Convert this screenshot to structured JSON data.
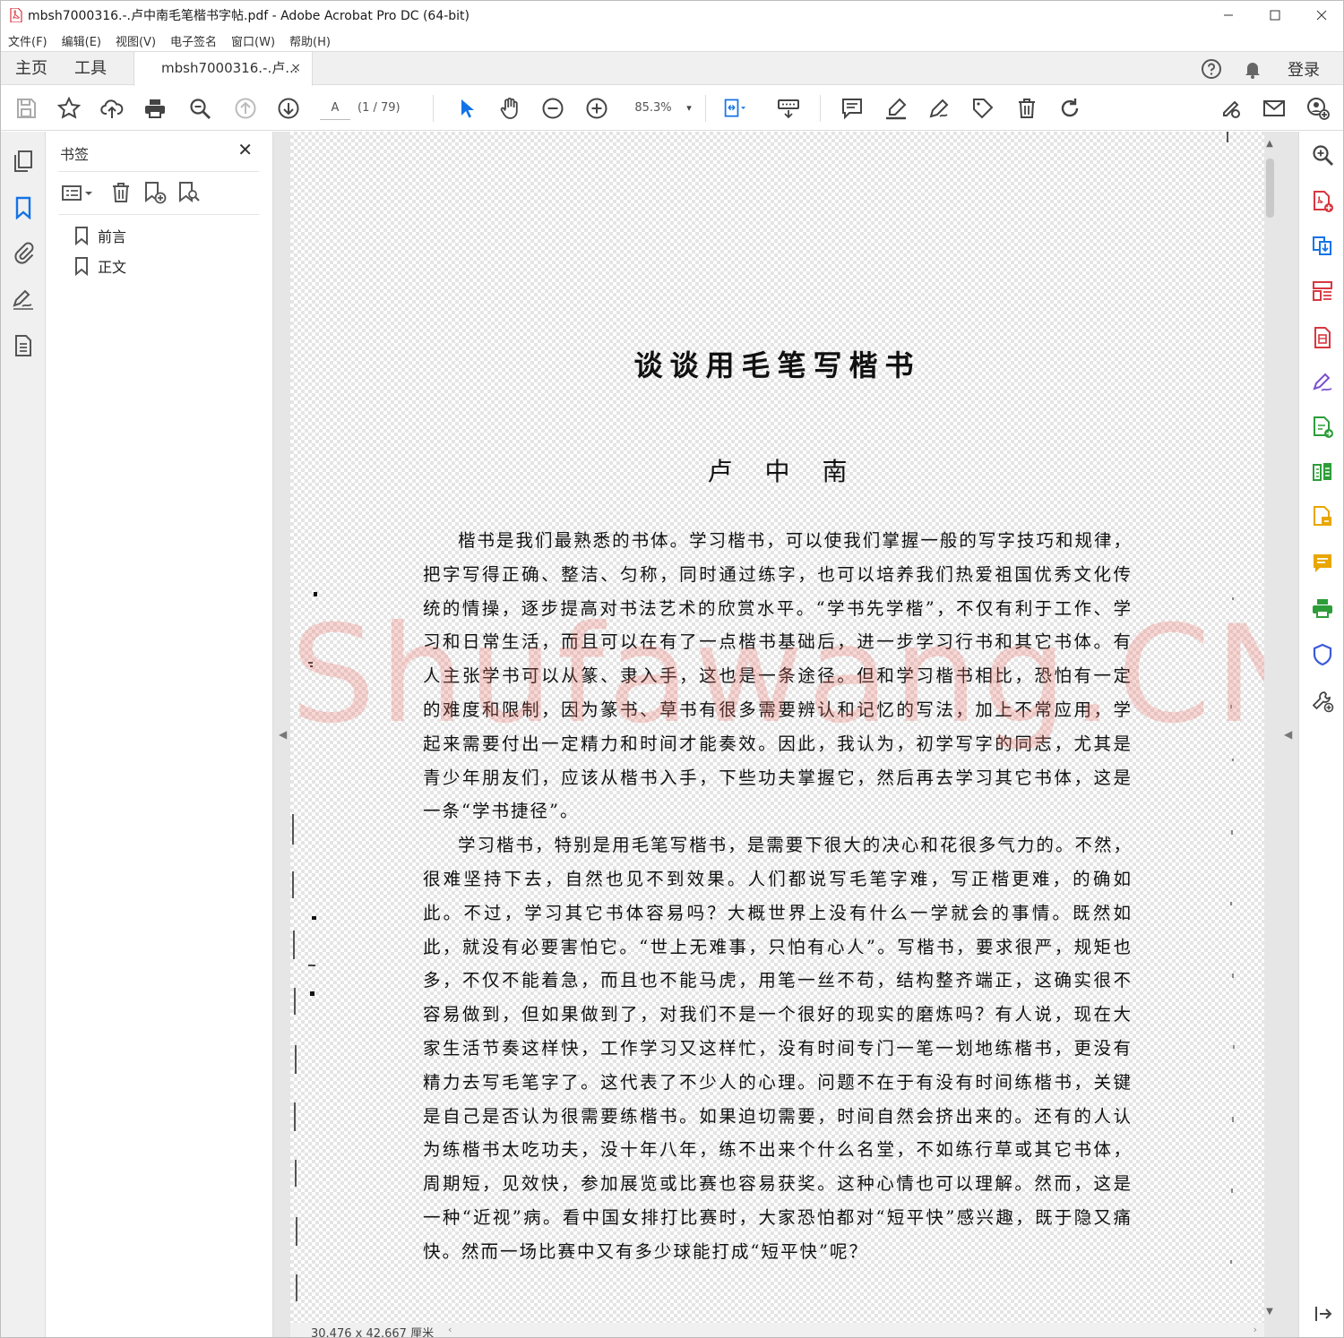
{
  "window": {
    "title": "mbsh7000316.-.卢中南毛笔楷书字帖.pdf - Adobe Acrobat Pro DC (64-bit)",
    "minimize": "—",
    "maximize": "☐",
    "close": "✕"
  },
  "menu": [
    "文件(F)",
    "编辑(E)",
    "视图(V)",
    "电子签名",
    "窗口(W)",
    "帮助(H)"
  ],
  "tabs": {
    "home": "主页",
    "tools": "工具",
    "document": "mbsh7000316.-.卢...",
    "document_close": "×",
    "login": "登录"
  },
  "toolbar": {
    "page_input": "A",
    "page_count": "(1 / 79)",
    "zoom": "85.3%",
    "zoom_dropdown": "▾"
  },
  "bookmarks": {
    "title": "书签",
    "close": "✕",
    "items": [
      "前言",
      "正文"
    ]
  },
  "document": {
    "title": "谈谈用毛笔写楷书",
    "author": "卢中南",
    "paragraphs": [
      "楷书是我们最熟悉的书体。学习楷书，可以使我们掌握一般的写字技巧和规律，把字写得正确、整洁、匀称，同时通过练字，也可以培养我们热爱祖国优秀文化传统的情操，逐步提高对书法艺术的欣赏水平。“学书先学楷”，不仅有利于工作、学习和日常生活，而且可以在有了一点楷书基础后，进一步学习行书和其它书体。有人主张学书可以从篆、隶入手，这也是一条途径。但和学习楷书相比，恐怕有一定的难度和限制，因为篆书、草书有很多需要辨认和记忆的写法，加上不常应用，学起来需要付出一定精力和时间才能奏效。因此，我认为，初学写字的同志，尤其是青少年朋友们，应该从楷书入手，下些功夫掌握它，然后再去学习其它书体，这是一条“学书捷径”。",
      "学习楷书，特别是用毛笔写楷书，是需要下很大的决心和花很多气力的。不然，很难坚持下去，自然也见不到效果。人们都说写毛笔字难，写正楷更难，的确如此。不过，学习其它书体容易吗？大概世界上没有什么一学就会的事情。既然如此，就没有必要害怕它。“世上无难事，只怕有心人”。写楷书，要求很严，规矩也多，不仅不能着急，而且也不能马虎，用笔一丝不苟，结构整齐端正，这确实很不容易做到，但如果做到了，对我们不是一个很好的现实的磨炼吗？有人说，现在大家生活节奏这样快，工作学习又这样忙，没有时间专门一笔一划地练楷书，更没有精力去写毛笔字了。这代表了不少人的心理。问题不在于有没有时间练楷书，关键是自己是否认为很需要练楷书。如果迫切需要，时间自然会挤出来的。还有的人认为练楷书太吃功夫，没十年八年，练不出来个什么名堂，不如练行草或其它书体，周期短，见效快，参加展览或比赛也容易获奖。这种心情也可以理解。然而，这是一种“近视”病。看中国女排打比赛时，大家恐怕都对“短平快”感兴趣，既于隐又痛快。然而一场比赛中又有多少球能打成“短平快”呢？"
    ],
    "watermark": "Shufawang.CN",
    "page_size": "30.476 x 42.667 厘米"
  },
  "icons": {
    "app": "acrobat-pdf-icon",
    "accent": "#1473e6",
    "pdf_red": "#d7373f",
    "tool_green": "#2d9d3a",
    "tool_yellow": "#e8a600",
    "tool_purple": "#7a4fd0"
  }
}
